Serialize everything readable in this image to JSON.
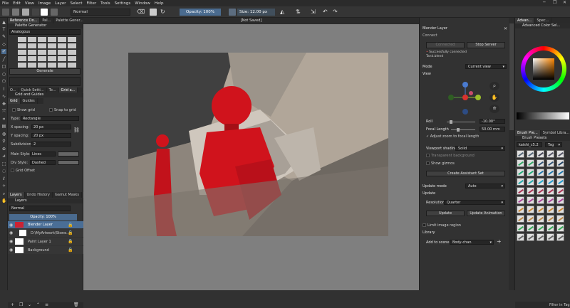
{
  "menu": [
    "File",
    "Edit",
    "View",
    "Image",
    "Layer",
    "Select",
    "Filter",
    "Tools",
    "Settings",
    "Window",
    "Help"
  ],
  "toolbar": {
    "blend_mode": "Normal",
    "opacity": "Opacity: 100%",
    "size": "Size: 12.00 px"
  },
  "left_dock": {
    "tabs_top": [
      "Reference Do...",
      "Pal...",
      "Palette Gener..."
    ],
    "palette_header": "Palette Generator",
    "palette_mode": "Analogous",
    "generate": "Generate",
    "tabs_mid": [
      "O...",
      "Quick Setti...",
      "To...",
      "Grid a..."
    ],
    "grid_header": "Grid and Guides",
    "grid_tabs": [
      "Grid",
      "Guides"
    ],
    "show_grid": "Show grid",
    "snap_grid": "Snap to grid",
    "type_label": "Type:",
    "type_value": "Rectangle",
    "xspacing_label": "X spacing:",
    "xspacing_value": "20 px",
    "yspacing_label": "Y spacing:",
    "yspacing_value": "20 px",
    "subdiv_label": "Subdivision:",
    "subdiv_value": "2",
    "mainstyle_label": "Main Style:",
    "mainstyle_value": "Lines",
    "divstyle_label": "Div Style:",
    "divstyle_value": "Dashed",
    "grid_offset": "Grid Offset",
    "layer_tabs": [
      "Layers",
      "Undo History",
      "Gamut Masks"
    ],
    "layers_header": "Layers",
    "layer_blend": "Normal",
    "layer_opacity": "Opacity: 100%",
    "layers": [
      {
        "name": "Blender Layer",
        "selected": true
      },
      {
        "name": "D:\\MyArtwork\\Stone...",
        "selected": false
      },
      {
        "name": "Paint Layer 1",
        "selected": false
      },
      {
        "name": "Background",
        "selected": false
      }
    ]
  },
  "canvas": {
    "doc_title": "[Not Saved]"
  },
  "blender_panel": {
    "title": "Blender Layer",
    "connect": "Connect",
    "connected_btn": "Connected",
    "stop_btn": "Stop Server",
    "status": "Successfully connected",
    "status2": "Tank.blend",
    "mode_label": "Mode",
    "mode_value": "Current view",
    "view_label": "View",
    "roll_label": "Roll",
    "roll_value": "-10.00°",
    "focal_label": "Focal Length",
    "focal_value": "50.00 mm",
    "adjust_zoom": "Adjust zoom to focal length",
    "viewport_label": "Viewport shading:",
    "viewport_value": "Solid",
    "transparent_bg": "Transparent background",
    "show_gizmos": "Show gizmos",
    "create_assistant": "Create Assistant Set",
    "update_mode_label": "Update mode",
    "update_mode_value": "Auto",
    "update_label": "Update",
    "resolution_label": "Resolution",
    "resolution_value": "Quarter",
    "update_btn": "Update",
    "update_anim_btn": "Update Animation",
    "limit_region": "Limit image region",
    "library_label": "Library",
    "add_scene_label": "Add to scene:",
    "add_scene_value": "Body-chan"
  },
  "right_dock": {
    "tabs_top": [
      "Advan...",
      "Spec..."
    ],
    "color_header": "Advanced Color Sel...",
    "tabs_mid": [
      "Brush Pre...",
      "Symbol Libra..."
    ],
    "brush_header": "Brush Presets",
    "brush_filter": "kaishi_c5.2",
    "brush_tag": "Tag",
    "filter_in_tag": "Filter in Tag"
  },
  "colors": {
    "accent": "#4a6b8f",
    "selected_row": "#4a6e96",
    "robot_red": "#d0131c",
    "scene_bg": "#b4a99c"
  }
}
